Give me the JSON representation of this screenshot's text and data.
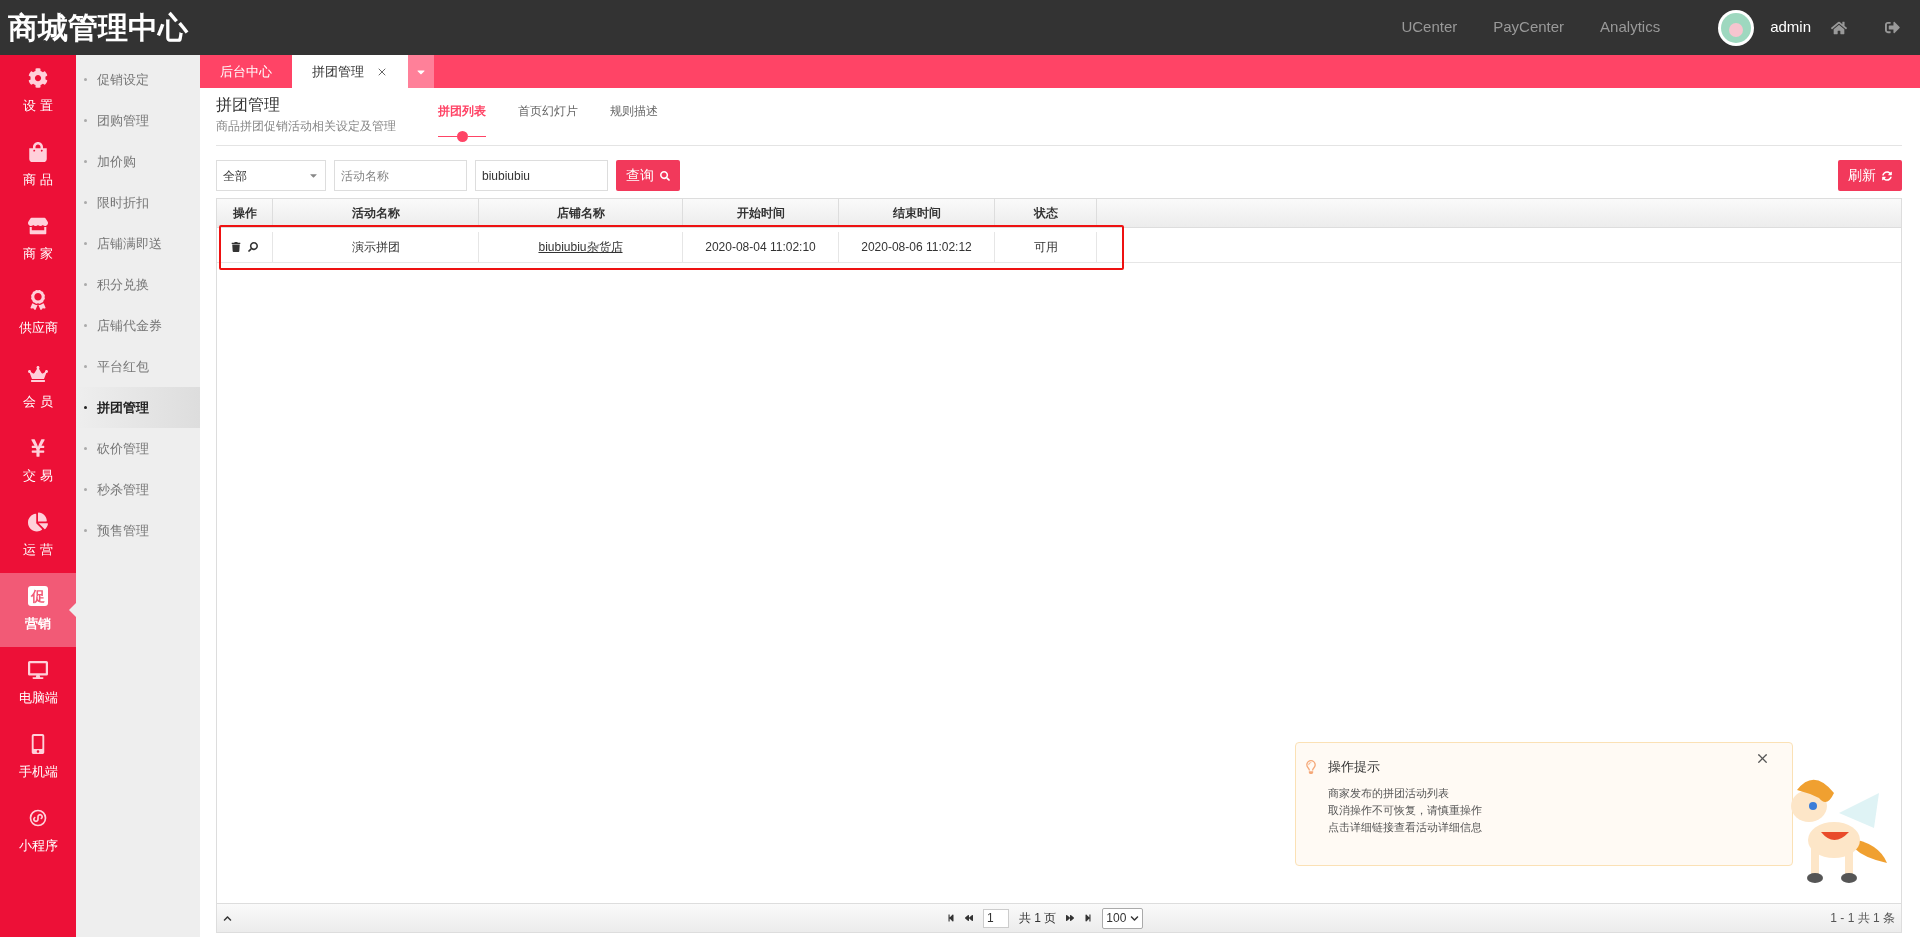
{
  "header": {
    "title": "商城管理中心",
    "links": [
      "UCenter",
      "PayCenter",
      "Analytics"
    ],
    "user": "admin"
  },
  "nav": [
    {
      "label": "设 置",
      "selected": false
    },
    {
      "label": "商 品",
      "selected": false
    },
    {
      "label": "商 家",
      "selected": false
    },
    {
      "label": "供应商",
      "selected": false
    },
    {
      "label": "会 员",
      "selected": false
    },
    {
      "label": "交 易",
      "selected": false
    },
    {
      "label": "运 营",
      "selected": false
    },
    {
      "label": "营销",
      "glyph": "促",
      "selected": true
    },
    {
      "label": "电脑端",
      "selected": false
    },
    {
      "label": "手机端",
      "selected": false
    },
    {
      "label": "小程序",
      "selected": false
    }
  ],
  "submenu": [
    {
      "label": "促销设定",
      "selected": false
    },
    {
      "label": "团购管理",
      "selected": false
    },
    {
      "label": "加价购",
      "selected": false
    },
    {
      "label": "限时折扣",
      "selected": false
    },
    {
      "label": "店铺满即送",
      "selected": false
    },
    {
      "label": "积分兑换",
      "selected": false
    },
    {
      "label": "店铺代金券",
      "selected": false
    },
    {
      "label": "平台红包",
      "selected": false
    },
    {
      "label": "拼团管理",
      "selected": true
    },
    {
      "label": "砍价管理",
      "selected": false
    },
    {
      "label": "秒杀管理",
      "selected": false
    },
    {
      "label": "预售管理",
      "selected": false
    }
  ],
  "page_tabs": [
    {
      "label": "后台中心",
      "selected": false,
      "closable": false
    },
    {
      "label": "拼团管理",
      "selected": true,
      "closable": true
    }
  ],
  "page": {
    "title": "拼团管理",
    "subtitle": "商品拼团促销活动相关设定及管理"
  },
  "tabs": [
    {
      "label": "拼团列表",
      "selected": true
    },
    {
      "label": "首页幻灯片",
      "selected": false
    },
    {
      "label": "规则描述",
      "selected": false
    }
  ],
  "filters": {
    "select": "全部",
    "name_placeholder": "活动名称",
    "shop_value": "biubiubiu",
    "search_button": "查询",
    "refresh_button": "刷新"
  },
  "table": {
    "columns": [
      "操作",
      "活动名称",
      "店铺名称",
      "开始时间",
      "结束时间",
      "状态"
    ],
    "rows": [
      {
        "name": "演示拼团",
        "shop": "biubiubiu杂货店",
        "start": "2020-08-04 11:02:10",
        "end": "2020-08-06 11:02:12",
        "status": "可用",
        "highlighted": true
      }
    ]
  },
  "pager": {
    "page": "1",
    "total_pages": "共 1 页",
    "page_size": "100",
    "summary": "1 - 1 共 1 条"
  },
  "tip": {
    "title": "操作提示",
    "lines": [
      "商家发布的拼团活动列表",
      "取消操作不可恢复，请慎重操作",
      "点击详细链接查看活动详细信息"
    ]
  }
}
